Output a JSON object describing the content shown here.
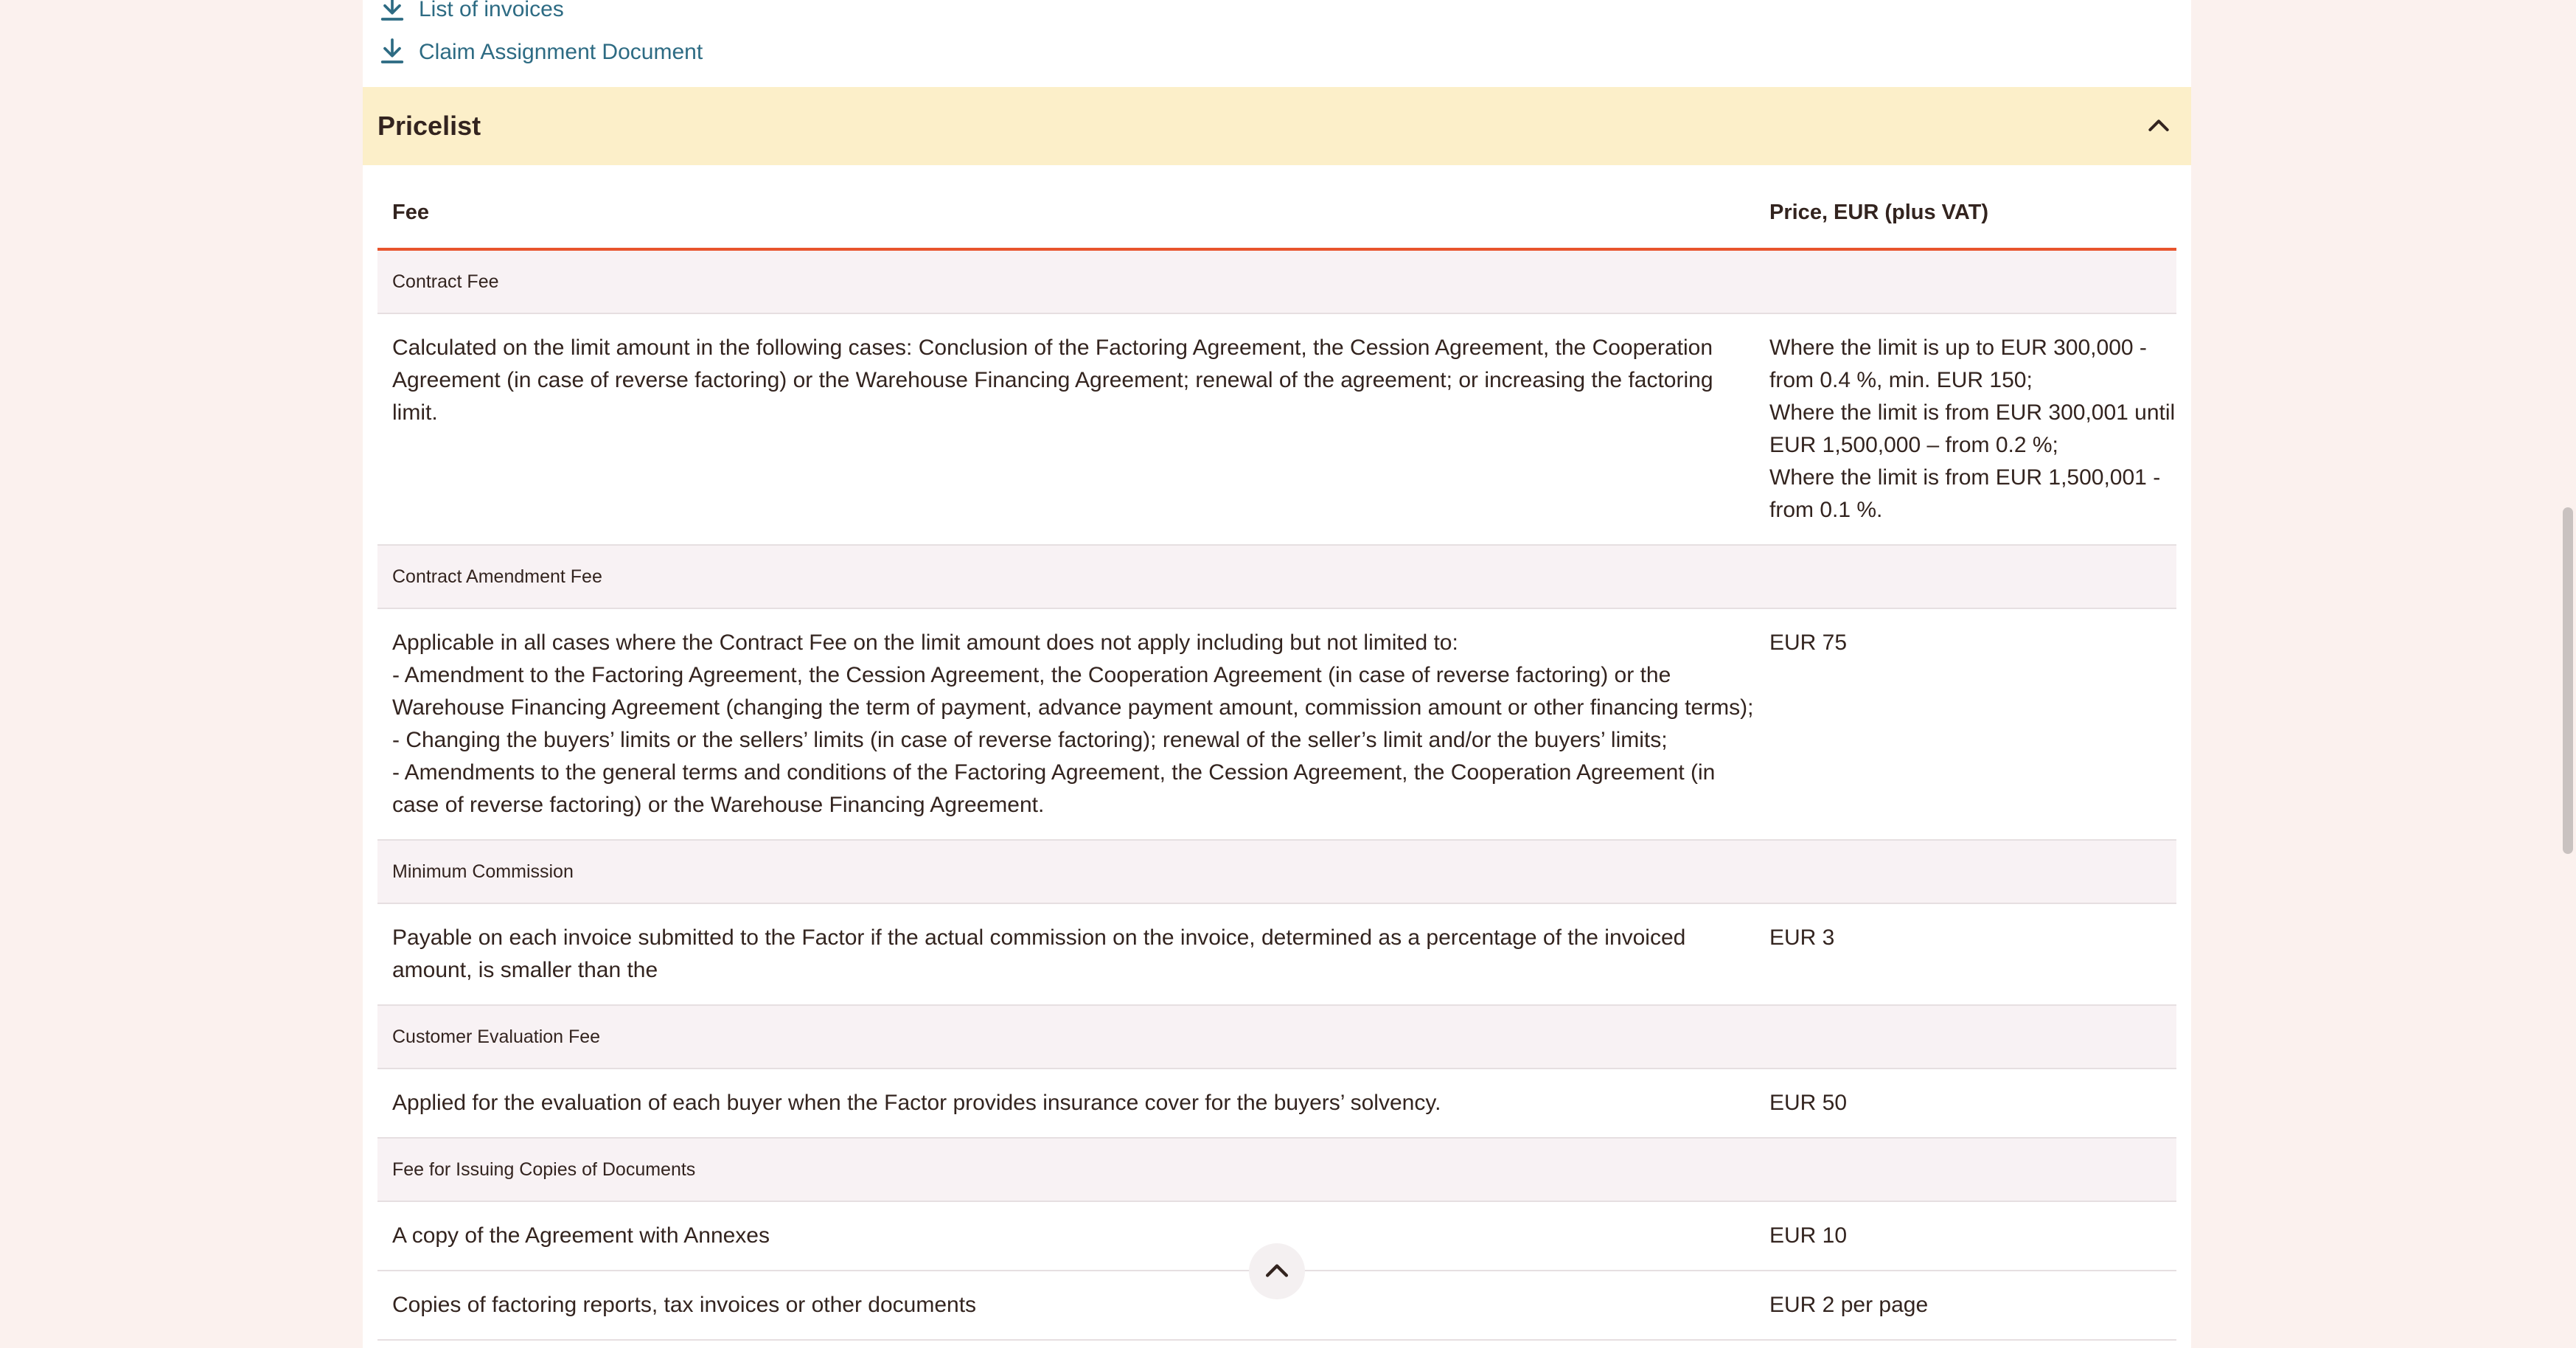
{
  "downloads": [
    {
      "label": "List of invoices",
      "icon": "download-icon"
    },
    {
      "label": "Claim Assignment Document",
      "icon": "download-icon"
    }
  ],
  "pricelist": {
    "title": "Pricelist",
    "expanded": true,
    "header": {
      "fee": "Fee",
      "price": "Price, EUR (plus VAT)"
    },
    "groups": [
      {
        "name": "Contract Fee",
        "rows": [
          {
            "fee": "Calculated on the limit amount in the following cases: Conclusion of the Factoring Agreement, the Cession Agreement, the Cooperation Agreement (in case of reverse factoring) or the Warehouse Financing Agreement; renewal of the agreement; or increasing the factoring limit.",
            "price": "Where the limit is up to EUR 300,000 - from 0.4 %, min. EUR 150;\nWhere the limit is from EUR 300,001 until EUR 1,500,000 – from 0.2 %;\nWhere the limit is from EUR 1,500,001 - from 0.1 %."
          }
        ]
      },
      {
        "name": "Contract Amendment Fee",
        "rows": [
          {
            "fee": "Applicable in all cases where the Contract Fee on the limit amount does not apply including but not limited to:\n- Amendment to the Factoring Agreement, the Cession Agreement, the Cooperation Agreement (in case of reverse factoring) or the Warehouse Financing Agreement (changing the term of payment, advance payment amount, commission amount or other financing terms);\n- Changing the buyers’ limits or the sellers’ limits (in case of reverse factoring); renewal of the seller’s limit and/or the buyers’ limits;\n- Amendments to the general terms and conditions of the Factoring Agreement, the Cession Agreement, the Cooperation Agreement (in case of reverse factoring) or the Warehouse Financing Agreement.",
            "price": "EUR 75"
          }
        ]
      },
      {
        "name": "Minimum Commission",
        "rows": [
          {
            "fee": "Payable on each invoice submitted to the Factor if the actual commission on the invoice, determined as a percentage of the invoiced amount, is smaller than the",
            "price": "EUR 3"
          }
        ]
      },
      {
        "name": "Customer Evaluation Fee",
        "rows": [
          {
            "fee": "Applied for the evaluation of each buyer when the Factor provides insurance cover for the buyers’ solvency.",
            "price": "EUR 50"
          }
        ]
      },
      {
        "name": "Fee for Issuing Copies of Documents",
        "rows": [
          {
            "fee": "A copy of the Agreement with Annexes",
            "price": "EUR 10"
          },
          {
            "fee": "Copies of factoring reports, tax invoices or other documents",
            "price": "EUR 2 per page"
          }
        ]
      }
    ]
  },
  "icons": {
    "collapse": "chevron-up-icon",
    "scroll_top": "chevron-up-icon"
  },
  "colors": {
    "accordion_bg": "#fcefc9",
    "accent_line": "#e8542d",
    "link": "#2d6b83",
    "group_bg": "#f8f2f4"
  }
}
